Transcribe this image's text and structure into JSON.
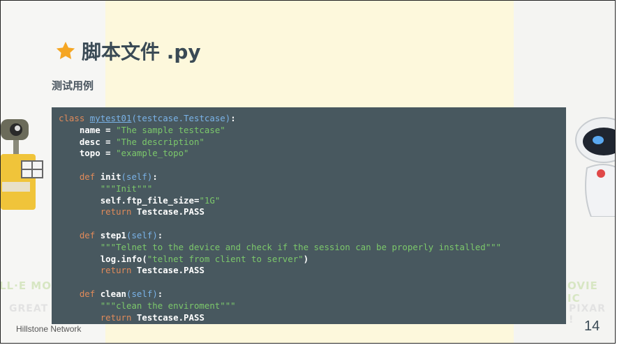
{
  "slide": {
    "title": "脚本文件 .py",
    "subtitle": "测试用例",
    "footer": "Hillstone Network",
    "page_number": "14",
    "star_color": "#f5a623"
  },
  "background": {
    "left_caption": "LL·E MO",
    "left_sub": "GREAT",
    "right_caption": "OVIE IC",
    "right_sub": "PIXAR !"
  },
  "code": {
    "l1": {
      "kw": "class",
      "name": "mytest01",
      "args": "(testcase.Testcase)",
      "end": ":"
    },
    "l2": {
      "ident": "name",
      "op": " = ",
      "val": "\"The sample testcase\""
    },
    "l3": {
      "ident": "desc",
      "op": " = ",
      "val": "\"The description\""
    },
    "l4": {
      "ident": "topo",
      "op": " = ",
      "val": "\"example_topo\""
    },
    "l6": {
      "kw": "def",
      "name": "init",
      "args": "(self)",
      "end": ":"
    },
    "l7": {
      "doc": "\"\"\"Init\"\"\""
    },
    "l8": {
      "ident": "self.ftp_file_size",
      "op": "=",
      "val": "\"1G\""
    },
    "l9": {
      "kw": "return",
      "val": "Testcase.PASS"
    },
    "l11": {
      "kw": "def",
      "name": "step1",
      "args": "(self)",
      "end": ":"
    },
    "l12": {
      "doc": "\"\"\"Telnet to the device and check if the session can be properly installed\"\"\""
    },
    "l13": {
      "ident": "log.info(",
      "val": "\"telnet from client to server\"",
      "end": ")"
    },
    "l14": {
      "kw": "return",
      "val": "Testcase.PASS"
    },
    "l16": {
      "kw": "def",
      "name": "clean",
      "args": "(self)",
      "end": ":"
    },
    "l17": {
      "doc": "\"\"\"clean the enviroment\"\"\""
    },
    "l18": {
      "kw": "return",
      "val": "Testcase.PASS"
    }
  }
}
